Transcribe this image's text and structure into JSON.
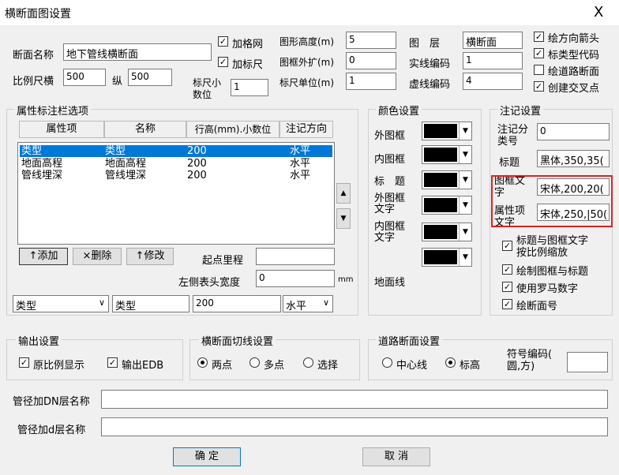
{
  "window": {
    "title": "横断面图设置",
    "close": "X"
  },
  "top": {
    "section_name_label": "断面名称",
    "section_name_value": "地下管线横断面",
    "scale_h_label": "比例尺横",
    "scale_h_value": "500",
    "scale_v_label": "纵",
    "scale_v_value": "500",
    "add_grid_label": "加格网",
    "add_ruler_label": "加标尺",
    "ruler_decimal_label_1": "标尺小",
    "ruler_decimal_label_2": "数位",
    "ruler_decimal_value": "1",
    "graph_height_label": "图形高度(m)",
    "graph_height_value": "5",
    "frame_expand_label": "图框外扩(m)",
    "frame_expand_value": "0",
    "ruler_unit_label": "标尺单位(m)",
    "ruler_unit_value": "1",
    "layer_label": "图　层",
    "layer_value": "横断面",
    "solid_code_label": "实线编码",
    "solid_code_value": "1",
    "dashed_code_label": "虚线编码",
    "dashed_code_value": "4",
    "options": [
      {
        "label": "绘方向箭头",
        "checked": true
      },
      {
        "label": "标类型代码",
        "checked": true
      },
      {
        "label": "绘道路断面",
        "checked": false
      },
      {
        "label": "创建交叉点",
        "checked": true
      }
    ]
  },
  "attr": {
    "title": "属性标注栏选项",
    "headers": [
      "属性项",
      "名称",
      "行高(mm).小数位",
      "注记方向"
    ],
    "rows": [
      {
        "c1": "类型",
        "c2": "类型",
        "c3": "200",
        "c4": "水平",
        "selected": true
      },
      {
        "c1": "地面高程",
        "c2": "地面高程",
        "c3": "200",
        "c4": "水平",
        "selected": false
      },
      {
        "c1": "管线埋深",
        "c2": "管线埋深",
        "c3": "200",
        "c4": "水平",
        "selected": false
      }
    ],
    "add": "↑添加",
    "delete": "×删除",
    "modify": "↑修改",
    "start_mileage_label": "起点里程",
    "start_mileage_value": "",
    "left_header_width_label": "左侧表头宽度",
    "left_header_width_value": "0",
    "unit_mm": "mm",
    "edit_c1": "类型",
    "edit_c2": "类型",
    "edit_c3": "200",
    "edit_c4": "水平"
  },
  "color": {
    "title": "颜色设置",
    "items": [
      "外图框",
      "内图框",
      "标　题",
      "外图框\n文字",
      "内图框\n文字",
      "地面线"
    ]
  },
  "note": {
    "title": "注记设置",
    "layer_label": "注记分类号",
    "layer_value": "0",
    "title_label": "标题",
    "title_value": "黑体,350,35(",
    "frame_text_label": "图框文字",
    "frame_text_value": "宋体,200,20(",
    "attr_text_label": "属性项文字",
    "attr_text_value": "宋体,250,|50(",
    "options": [
      {
        "label": "标题与图框文字\n按比例缩放",
        "checked": true
      },
      {
        "label": "绘制图框与标题",
        "checked": true
      },
      {
        "label": "使用罗马数字",
        "checked": true
      },
      {
        "label": "绘断面号",
        "checked": true
      }
    ]
  },
  "output": {
    "title": "输出设置",
    "original_scale": "原比例显示",
    "output_edb": "输出EDB"
  },
  "cutline": {
    "title": "横断面切线设置",
    "opts": [
      "两点",
      "多点",
      "选择"
    ]
  },
  "road": {
    "title": "道路断面设置",
    "opts": [
      "中心线",
      "标高"
    ],
    "symbol_label": "符号编码(\n圆,方)",
    "symbol_value": ""
  },
  "dn_layer_label": "管径加DN层名称",
  "dn_layer_value": "",
  "d_layer_label": "管径加d层名称",
  "d_layer_value": "",
  "ok": "确 定",
  "cancel": "取 消"
}
